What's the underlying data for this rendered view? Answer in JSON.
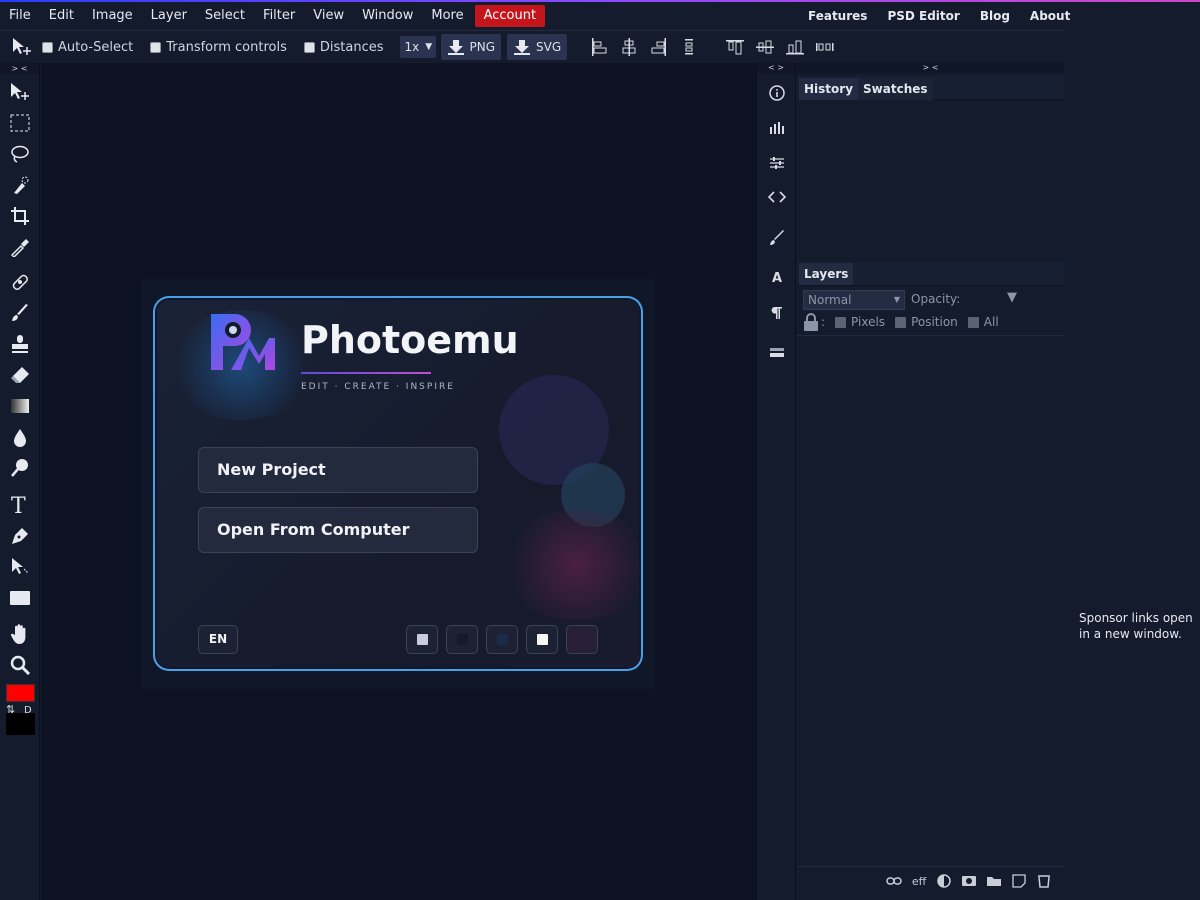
{
  "menubar": {
    "items": [
      "File",
      "Edit",
      "Image",
      "Layer",
      "Select",
      "Filter",
      "View",
      "Window",
      "More"
    ],
    "account": "Account",
    "right_items": [
      "Features",
      "PSD Editor",
      "Blog",
      "About"
    ]
  },
  "toolbar": {
    "auto_select": "Auto-Select",
    "transform_controls": "Transform controls",
    "distances": "Distances",
    "scale": "1x",
    "png": "PNG",
    "svg": "SVG"
  },
  "left_collapse": "> <",
  "iconcol_collapse": "< >",
  "panel_collapse": "> <",
  "dialog": {
    "brand": "Photoemu",
    "tagline": "EDIT · CREATE · INSPIRE",
    "new_project": "New Project",
    "open_from_computer": "Open From Computer",
    "language": "EN",
    "theme_colors": [
      "#c8ccd8",
      "#141a2a",
      "#1c2b48",
      "#f5f5f5",
      "#2c1e3a"
    ]
  },
  "panels": {
    "history_tab": "History",
    "swatches_tab": "Swatches",
    "layers_tab": "Layers",
    "blend_mode": "Normal",
    "opacity_label": "Opacity:",
    "lock_sep": ":",
    "pixels": "Pixels",
    "position": "Position",
    "all": "All",
    "eff": "eff"
  },
  "iconcol": {
    "character_label": "A"
  },
  "tools": {
    "default_colors": "D",
    "swap": "⇅"
  },
  "colors": {
    "foreground": "#ff0000",
    "background": "#000000",
    "account": "#c4141c"
  },
  "sponsor": {
    "text": "Sponsor links open in a new window."
  }
}
